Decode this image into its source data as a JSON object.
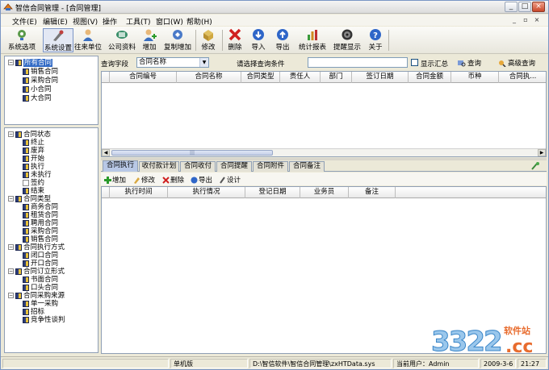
{
  "window": {
    "title": "智信合同管理 - [合同管理]",
    "controls": {
      "minimize": "_",
      "maximize": "□",
      "close": "×"
    },
    "mdi_controls": {
      "minimize": "_",
      "restore": "▫",
      "close": "×"
    }
  },
  "menu": {
    "items": [
      "文件(E)",
      "编辑(E)",
      "视图(V)",
      "操作",
      "工具(T)",
      "窗口(W)",
      "帮助(H)"
    ]
  },
  "toolbar": {
    "buttons": [
      {
        "label": "系统选项",
        "icon": "system-options-icon"
      },
      {
        "label": "系统设置",
        "icon": "system-settings-icon"
      },
      {
        "label": "往来单位",
        "icon": "contacts-icon"
      },
      {
        "label": "公司资料",
        "icon": "company-info-icon"
      },
      {
        "label": "增加",
        "icon": "add-icon"
      },
      {
        "label": "复制增加",
        "icon": "copy-add-icon"
      },
      {
        "label": "修改",
        "icon": "edit-icon"
      },
      {
        "label": "删除",
        "icon": "delete-icon"
      },
      {
        "label": "导入",
        "icon": "import-icon"
      },
      {
        "label": "导出",
        "icon": "export-icon"
      },
      {
        "label": "统计报表",
        "icon": "report-icon"
      },
      {
        "label": "提醒显示",
        "icon": "reminder-icon"
      },
      {
        "label": "关于",
        "icon": "about-icon"
      }
    ]
  },
  "tree_top": {
    "root": "所有合同",
    "children": [
      "销售合同",
      "采购合同",
      "小合同",
      "大合同"
    ]
  },
  "tree_bottom": {
    "groups": [
      {
        "label": "合同状态",
        "children": [
          "终止",
          "废弃",
          "开始",
          "执行",
          "未执行",
          "签约",
          "结束"
        ]
      },
      {
        "label": "合同类型",
        "children": [
          "商务合同",
          "租赁合同",
          "聘用合同",
          "采购合同",
          "销售合同"
        ]
      },
      {
        "label": "合同执行方式",
        "children": [
          "闭口合同",
          "开口合同"
        ]
      },
      {
        "label": "合同订立形式",
        "children": [
          "书面合同",
          "口头合同"
        ]
      },
      {
        "label": "合同采购来源",
        "children": [
          "单一采购",
          "招标",
          "竞争性谈判"
        ]
      }
    ]
  },
  "query": {
    "field_label": "查询字段",
    "field_value": "合同名称",
    "condition_label": "请选择查询条件",
    "condition_value": "",
    "show_summary_label": "显示汇总",
    "search_button": "查询",
    "advanced_button": "高级查询"
  },
  "main_grid": {
    "columns": [
      "合同编号",
      "合同名称",
      "合同类型",
      "责任人",
      "部门",
      "签订日期",
      "合同金额",
      "币种",
      "合同执..."
    ],
    "rows": []
  },
  "tabs": {
    "items": [
      "合同执行",
      "收付款计划",
      "合同收付",
      "合同提醒",
      "合同附件",
      "合同备注"
    ],
    "active": 0
  },
  "detail_toolbar": {
    "buttons": [
      {
        "label": "增加",
        "icon": "add-small-icon"
      },
      {
        "label": "修改",
        "icon": "edit-small-icon"
      },
      {
        "label": "删除",
        "icon": "delete-small-icon"
      },
      {
        "label": "导出",
        "icon": "export-small-icon"
      },
      {
        "label": "设计",
        "icon": "design-small-icon"
      }
    ]
  },
  "detail_grid": {
    "columns": [
      "执行时间",
      "执行情况",
      "登记日期",
      "业务员",
      "备注"
    ],
    "rows": []
  },
  "status": {
    "mode": "单机版",
    "path": "D:\\智信软件\\智信合同管理\\zxHTData.sys",
    "user": "当前用户：Admin",
    "date": "2009-3-6",
    "time": "21:27"
  },
  "watermark": {
    "number": "3322",
    "site": "软件站",
    "domain": ".cc"
  }
}
